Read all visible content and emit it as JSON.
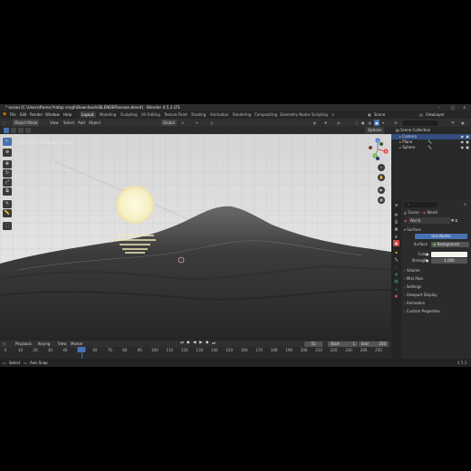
{
  "window": {
    "title": "* ocean [C:\\Users\\Rama Pratap singh\\Downloads\\BLENDER\\ocean.blend] - Blender 4.5.3 LTS",
    "min": "–",
    "max": "□",
    "close": "✕"
  },
  "menu": {
    "items": [
      "File",
      "Edit",
      "Render",
      "Window",
      "Help"
    ],
    "workspaces": [
      "Layout",
      "Modeling",
      "Sculpting",
      "UV Editing",
      "Texture Paint",
      "Shading",
      "Animation",
      "Rendering",
      "Compositing",
      "Geometry Nodes",
      "Scripting"
    ],
    "add_tab": "+",
    "scene_label": "Scene",
    "view_layer_label": "ViewLayer"
  },
  "viewport_header": {
    "mode": "Object Mode",
    "items": [
      "View",
      "Select",
      "Add",
      "Object"
    ],
    "transform": "Global",
    "options": "Options"
  },
  "viewport": {
    "view_name": "User Perspective",
    "collection": "(51) Scene Collection | Ocean",
    "gizmo_axes": [
      "X",
      "Y",
      "Z"
    ]
  },
  "timeline": {
    "menus": [
      "Playback",
      "Keying",
      "View",
      "Marker"
    ],
    "current_frame": "51",
    "start_label": "Start",
    "start": "1",
    "end_label": "End",
    "end": "250",
    "ticks": [
      "0",
      "10",
      "20",
      "30",
      "40",
      "50",
      "60",
      "70",
      "80",
      "90",
      "100",
      "110",
      "120",
      "130",
      "140",
      "150",
      "160",
      "170",
      "180",
      "190",
      "200",
      "210",
      "220",
      "230",
      "240",
      "250"
    ],
    "playhead_frame": 51,
    "frame_max": 250
  },
  "status_bar": {
    "select": "Select",
    "rotate": "Axis Snap",
    "version": "4.5.3"
  },
  "outliner": {
    "root": "Scene Collection",
    "items": [
      "Camera",
      "Plane",
      "Sphere"
    ]
  },
  "properties": {
    "search_placeholder": "",
    "breadcrumb_scene": "Scene",
    "breadcrumb_world": "World",
    "world_name": "World",
    "surface_section": "Surface",
    "use_nodes": "Use Nodes",
    "surface_label": "Surface",
    "surface_value": "Background",
    "color_label": "Color",
    "strength_label": "Strength",
    "strength_value": "1.000",
    "panels": [
      "Volume",
      "Mist Pass",
      "Settings",
      "Viewport Display",
      "Animation",
      "Custom Properties"
    ]
  },
  "colors": {
    "accent": "#4772b3",
    "sun": "#f6efc4",
    "ocean": "#3e3e3e",
    "background": "#d9d9d9"
  }
}
